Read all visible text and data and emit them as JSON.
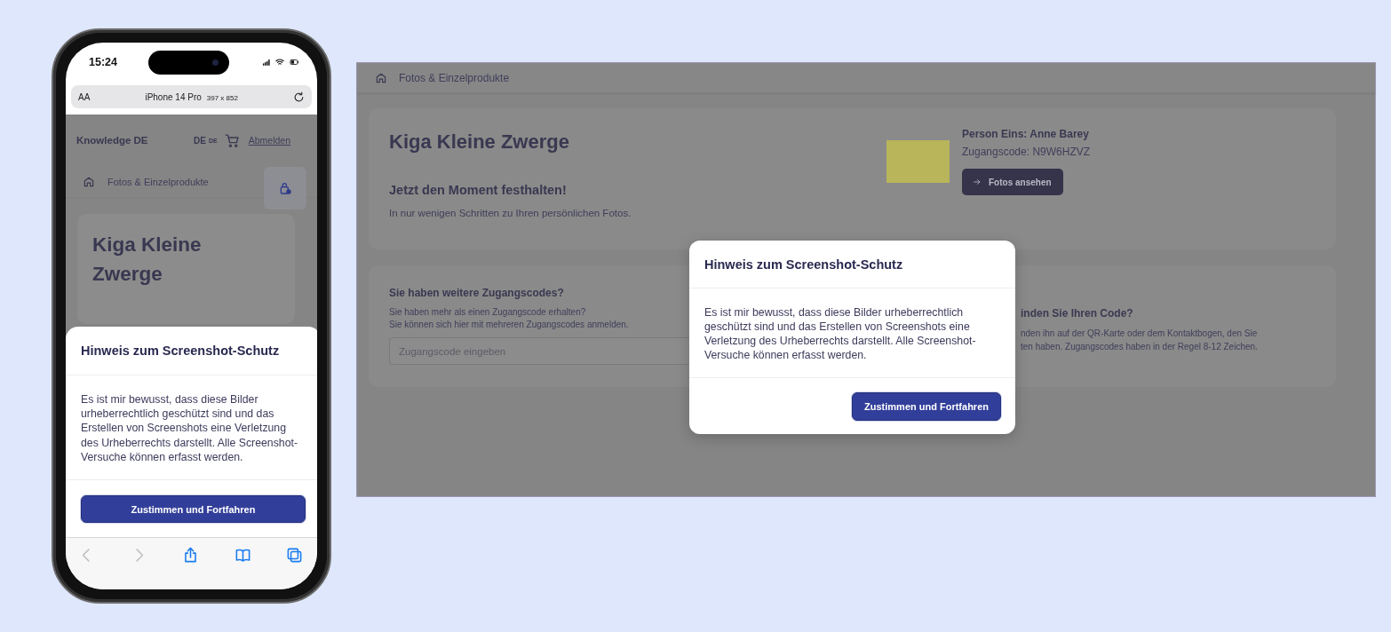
{
  "phone": {
    "status_bar": {
      "time": "15:24"
    },
    "address_bar": {
      "text_size": "AA",
      "device": "iPhone 14 Pro",
      "resolution": "397 x 852"
    },
    "header": {
      "brand": "Knowledge DE",
      "language": "DE",
      "language_code": "DE",
      "logout": "Abmelden"
    },
    "breadcrumb": "Fotos & Einzelprodukte",
    "title": "Kiga Kleine Zwerge",
    "modal": {
      "title": "Hinweis zum Screenshot-Schutz",
      "body": "Es ist mir bewusst, dass diese Bilder urheberrechtlich geschützt sind und das Erstellen von Screenshots eine Verletzung des Urheberrechts darstellt. Alle Screenshot-Versuche können erfasst werden.",
      "button": "Zustimmen und Fortfahren"
    },
    "toolbar": [
      {
        "kind": "back",
        "disabled": true
      },
      {
        "kind": "forward",
        "disabled": true
      },
      {
        "kind": "share",
        "disabled": false
      },
      {
        "kind": "bookmarks",
        "disabled": false
      },
      {
        "kind": "tabs",
        "disabled": false
      }
    ]
  },
  "desktop": {
    "breadcrumb": "Fotos & Einzelprodukte",
    "hero": {
      "title": "Kiga Kleine Zwerge",
      "subtitle": "Jetzt den Moment festhalten!",
      "text": "In nur wenigen Schritten zu Ihren persönlichen Fotos."
    },
    "person": {
      "name": "Person Eins: Anne Barey",
      "code": "Zugangscode: N9W6HZVZ",
      "button": "Fotos ansehen"
    },
    "codes": {
      "title": "Sie haben weitere Zugangscodes?",
      "lines": [
        "Sie haben mehr als einen Zugangscode erhalten?",
        "Sie können sich hier mit mehreren Zugangscodes anmelden."
      ],
      "placeholder": "Zugangscode eingeben"
    },
    "help": {
      "title": "inden Sie Ihren Code?",
      "lines": [
        "nden ihn auf der QR-Karte oder dem Kontaktbogen, den Sie",
        "ten haben. Zugangscodes haben in der Regel 8-12 Zeichen."
      ]
    },
    "modal": {
      "title": "Hinweis zum Screenshot-Schutz",
      "body": "Es ist mir bewusst, dass diese Bilder urheberrechtlich geschützt sind und das Erstellen von Screenshots eine Verletzung des Urheberrechts darstellt. Alle Screenshot-Versuche können erfasst werden.",
      "button": "Zustimmen und Fortfahren"
    }
  }
}
